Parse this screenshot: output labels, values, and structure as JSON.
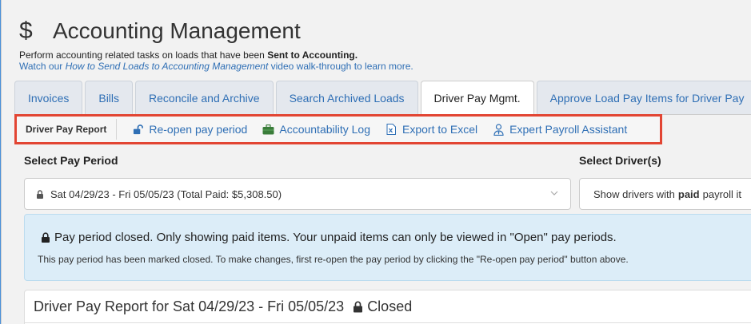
{
  "header": {
    "icon": "dollar-icon",
    "title": "Accounting Management",
    "desc_prefix": "Perform accounting related tasks on loads that have been ",
    "desc_bold": "Sent to Accounting.",
    "watch_prefix": "Watch our ",
    "watch_link": "How to Send Loads to Accounting Management",
    "watch_suffix": " video walk-through to learn more."
  },
  "tabs": [
    {
      "label": "Invoices"
    },
    {
      "label": "Bills"
    },
    {
      "label": "Reconcile and Archive"
    },
    {
      "label": "Search Archived Loads"
    },
    {
      "label": "Driver Pay Mgmt."
    },
    {
      "label": "Approve Load Pay Items for Driver Pay"
    }
  ],
  "subnav": {
    "title": "Driver Pay Report",
    "items": [
      {
        "label": "Re-open pay period",
        "icon": "unlock-icon"
      },
      {
        "label": "Accountability Log",
        "icon": "briefcase-icon"
      },
      {
        "label": "Export to Excel",
        "icon": "excel-file-icon"
      },
      {
        "label": "Expert Payroll Assistant",
        "icon": "user-tie-icon"
      }
    ]
  },
  "pay_period": {
    "label": "Select Pay Period",
    "value": "Sat 04/29/23 - Fri 05/05/23 (Total Paid: $5,308.50)"
  },
  "drivers": {
    "label": "Select Driver(s)",
    "value_prefix": "Show drivers with ",
    "value_bold": "paid",
    "value_suffix": " payroll it"
  },
  "alert": {
    "main": "Pay period closed. Only showing paid items. Your unpaid items can only be viewed in \"Open\" pay periods.",
    "sub": "This pay period has been marked closed. To make changes, first re-open the pay period by clicking the \"Re-open pay period\" button above."
  },
  "report": {
    "title": "Driver Pay Report for Sat 04/29/23 - Fri 05/05/23",
    "status": "Closed"
  },
  "colors": {
    "link": "#2f6fb5",
    "highlight": "#e24533",
    "alert_bg": "#dcedf8"
  }
}
